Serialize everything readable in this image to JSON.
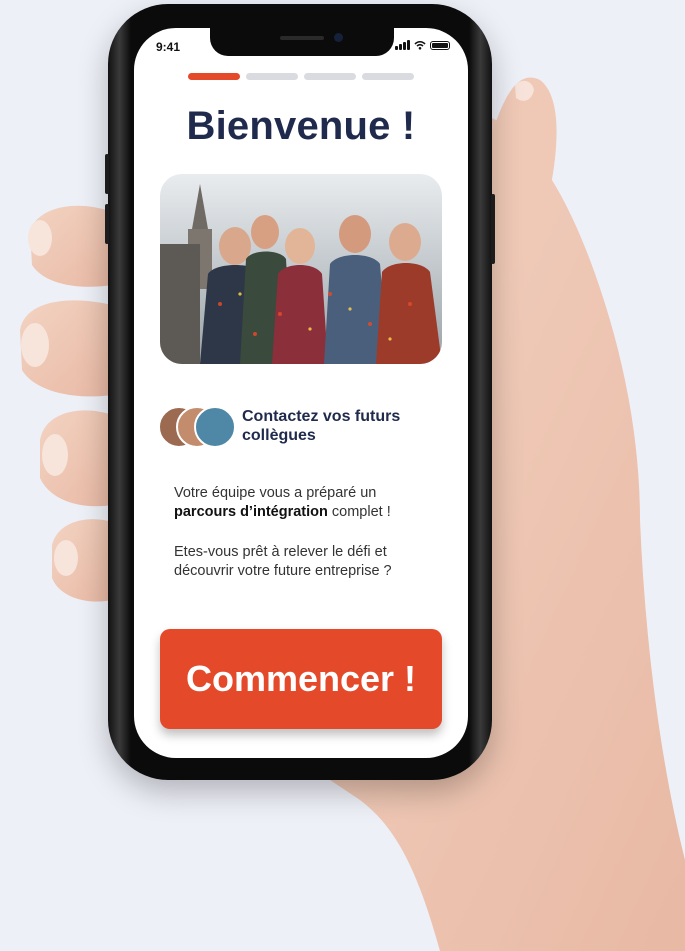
{
  "status_bar": {
    "time": "9:41"
  },
  "progress": {
    "total_steps": 4,
    "current_step": 1
  },
  "page": {
    "title": "Bienvenue !"
  },
  "contact": {
    "label": "Contactez vos futurs collègues"
  },
  "intro": {
    "line1_prefix": "Votre équipe vous a préparé un",
    "line1_bold": "parcours d’intégration",
    "line1_suffix": " complet !",
    "line2": "Etes-vous prêt à relever le défi et découvrir votre future entreprise ?"
  },
  "cta": {
    "label": "Commencer !"
  },
  "colors": {
    "accent": "#e4492a",
    "title": "#1f2a4c",
    "background": "#eef0f8"
  },
  "icons": [
    "signal-icon",
    "wifi-icon",
    "battery-icon"
  ]
}
